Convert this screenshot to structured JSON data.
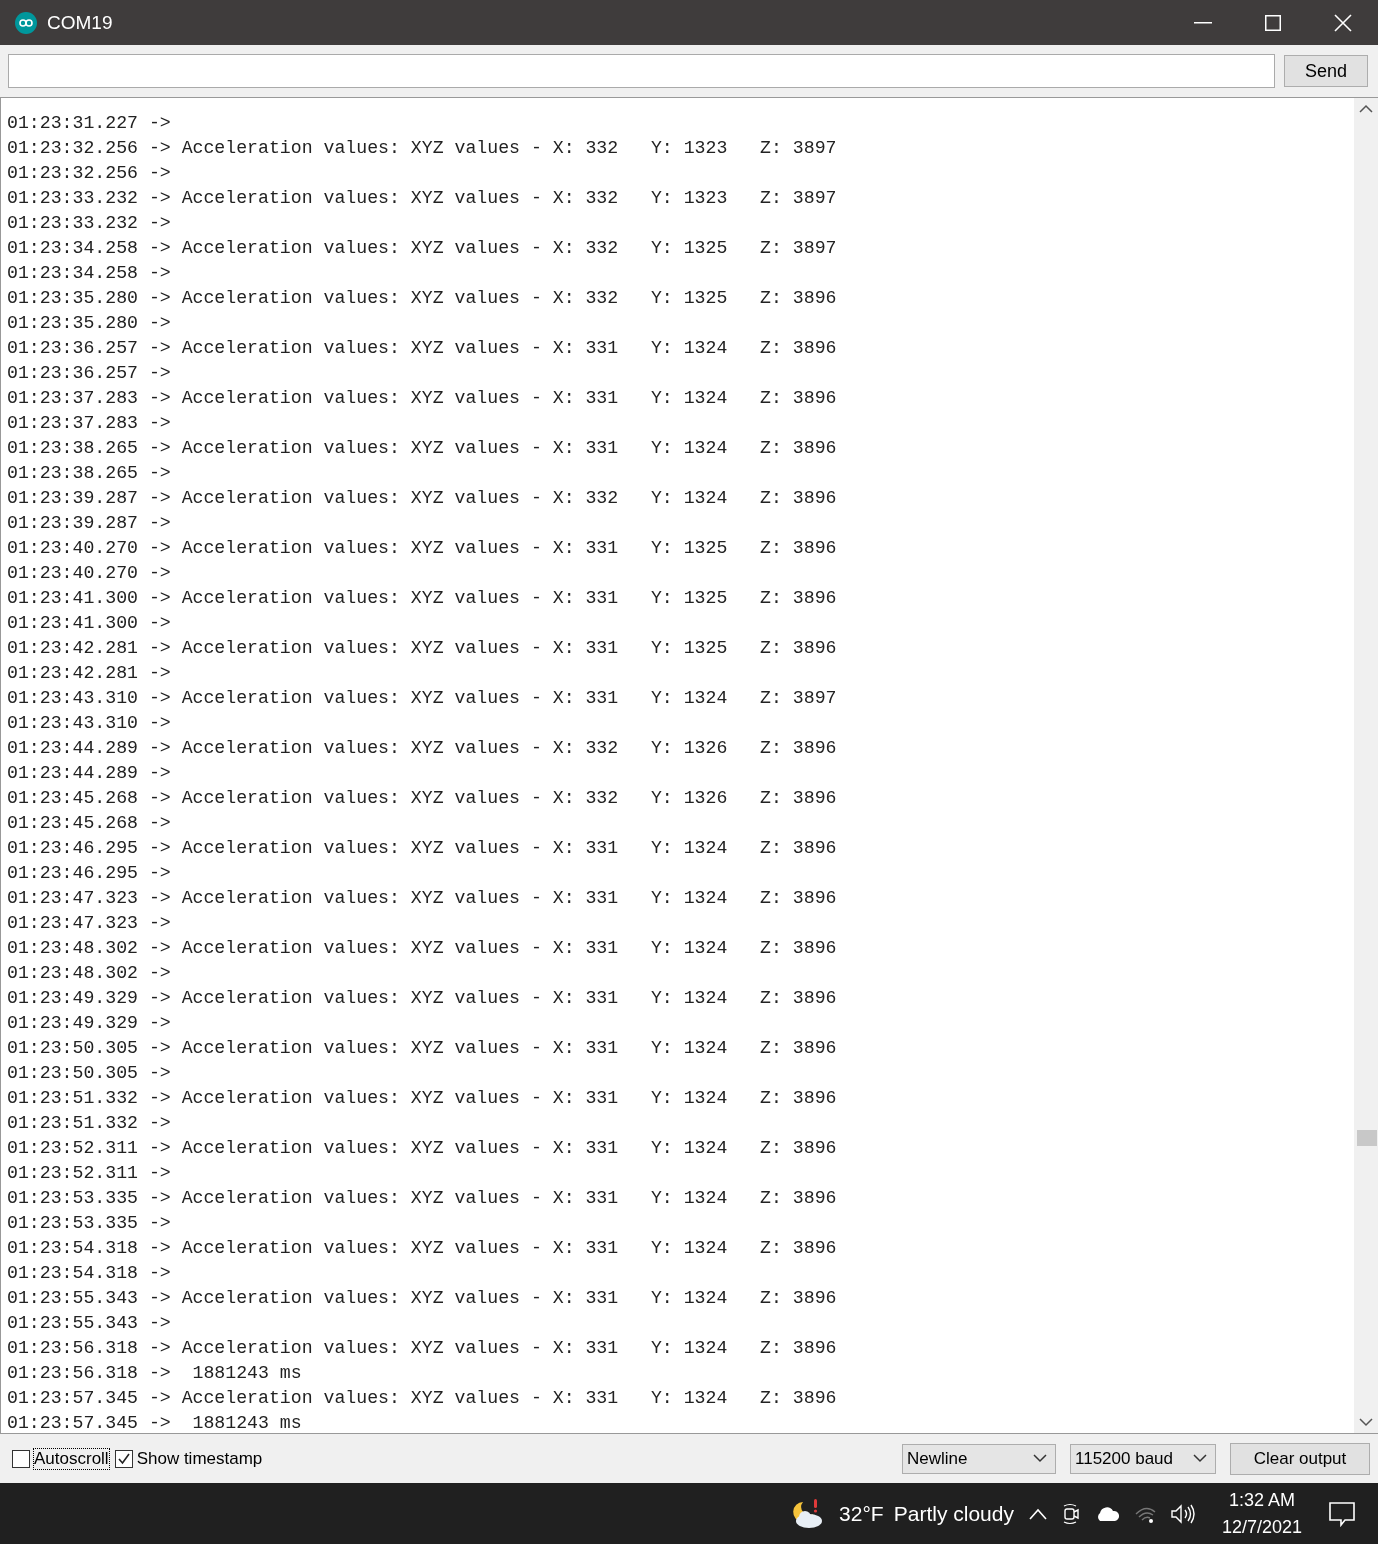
{
  "window": {
    "title": "COM19"
  },
  "send_button": "Send",
  "log": {
    "lines": [
      "01:23:31.227 ->",
      "01:23:32.256 -> Acceleration values: XYZ values - X: 332   Y: 1323   Z: 3897",
      "01:23:32.256 ->",
      "01:23:33.232 -> Acceleration values: XYZ values - X: 332   Y: 1323   Z: 3897",
      "01:23:33.232 ->",
      "01:23:34.258 -> Acceleration values: XYZ values - X: 332   Y: 1325   Z: 3897",
      "01:23:34.258 ->",
      "01:23:35.280 -> Acceleration values: XYZ values - X: 332   Y: 1325   Z: 3896",
      "01:23:35.280 ->",
      "01:23:36.257 -> Acceleration values: XYZ values - X: 331   Y: 1324   Z: 3896",
      "01:23:36.257 ->",
      "01:23:37.283 -> Acceleration values: XYZ values - X: 331   Y: 1324   Z: 3896",
      "01:23:37.283 ->",
      "01:23:38.265 -> Acceleration values: XYZ values - X: 331   Y: 1324   Z: 3896",
      "01:23:38.265 ->",
      "01:23:39.287 -> Acceleration values: XYZ values - X: 332   Y: 1324   Z: 3896",
      "01:23:39.287 ->",
      "01:23:40.270 -> Acceleration values: XYZ values - X: 331   Y: 1325   Z: 3896",
      "01:23:40.270 ->",
      "01:23:41.300 -> Acceleration values: XYZ values - X: 331   Y: 1325   Z: 3896",
      "01:23:41.300 ->",
      "01:23:42.281 -> Acceleration values: XYZ values - X: 331   Y: 1325   Z: 3896",
      "01:23:42.281 ->",
      "01:23:43.310 -> Acceleration values: XYZ values - X: 331   Y: 1324   Z: 3897",
      "01:23:43.310 ->",
      "01:23:44.289 -> Acceleration values: XYZ values - X: 332   Y: 1326   Z: 3896",
      "01:23:44.289 ->",
      "01:23:45.268 -> Acceleration values: XYZ values - X: 332   Y: 1326   Z: 3896",
      "01:23:45.268 ->",
      "01:23:46.295 -> Acceleration values: XYZ values - X: 331   Y: 1324   Z: 3896",
      "01:23:46.295 ->",
      "01:23:47.323 -> Acceleration values: XYZ values - X: 331   Y: 1324   Z: 3896",
      "01:23:47.323 ->",
      "01:23:48.302 -> Acceleration values: XYZ values - X: 331   Y: 1324   Z: 3896",
      "01:23:48.302 ->",
      "01:23:49.329 -> Acceleration values: XYZ values - X: 331   Y: 1324   Z: 3896",
      "01:23:49.329 ->",
      "01:23:50.305 -> Acceleration values: XYZ values - X: 331   Y: 1324   Z: 3896",
      "01:23:50.305 ->",
      "01:23:51.332 -> Acceleration values: XYZ values - X: 331   Y: 1324   Z: 3896",
      "01:23:51.332 ->",
      "01:23:52.311 -> Acceleration values: XYZ values - X: 331   Y: 1324   Z: 3896",
      "01:23:52.311 ->",
      "01:23:53.335 -> Acceleration values: XYZ values - X: 331   Y: 1324   Z: 3896",
      "01:23:53.335 ->",
      "01:23:54.318 -> Acceleration values: XYZ values - X: 331   Y: 1324   Z: 3896",
      "01:23:54.318 ->",
      "01:23:55.343 -> Acceleration values: XYZ values - X: 331   Y: 1324   Z: 3896",
      "01:23:55.343 ->",
      "01:23:56.318 -> Acceleration values: XYZ values - X: 331   Y: 1324   Z: 3896",
      "01:23:56.318 ->  1881243 ms",
      "01:23:57.345 -> Acceleration values: XYZ values - X: 331   Y: 1324   Z: 3896",
      "01:23:57.345 ->  1881243 ms"
    ]
  },
  "footer": {
    "checkboxes": [
      {
        "label": "Autoscroll",
        "checked": false,
        "focused": true
      },
      {
        "label": "Show timestamp",
        "checked": true,
        "focused": false
      }
    ],
    "line_ending": "Newline",
    "baud": "115200 baud",
    "clear_button": "Clear output"
  },
  "taskbar": {
    "temperature": "32°F",
    "weather": "Partly cloudy",
    "time": "1:32 AM",
    "date": "12/7/2021"
  }
}
